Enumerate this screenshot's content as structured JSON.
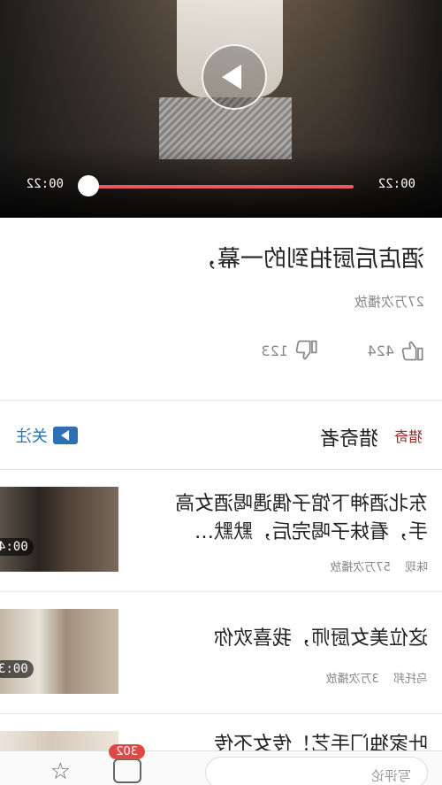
{
  "player": {
    "current_time": "00:22",
    "total_time": "00:22",
    "progress": 0.0
  },
  "video": {
    "title": "酒店后厨拍到的一幕，",
    "plays": "27万次播放",
    "likes": "424",
    "dislikes": "123"
  },
  "author": {
    "logo_text": "猎奇",
    "name": "猎奇者",
    "follow_label": "关注"
  },
  "related": [
    {
      "title": "东北酒神下馆子偶遇喝酒女高手，看妹子喝完后，默默…",
      "source": "味现",
      "plays": "57万次播放",
      "duration": "00:4"
    },
    {
      "title": "这位美女厨师，我喜欢你",
      "source": "乌托邦",
      "plays": "3万次播放",
      "duration": "00:3"
    },
    {
      "title": "叶家独门手艺！传女不传",
      "source": "",
      "plays": "",
      "duration": ""
    }
  ],
  "bottombar": {
    "comment_placeholder": "写评论",
    "badge": "302",
    "icons": [
      "message-icon",
      "star-icon"
    ]
  },
  "colors": {
    "progress": "#e85a5a",
    "follow": "#2f6fb3",
    "badge": "#e04848"
  }
}
